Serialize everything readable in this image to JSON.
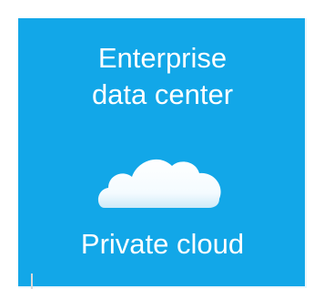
{
  "tile": {
    "title_line1": "Enterprise",
    "title_line2": "data center",
    "label": "Private cloud",
    "icon": "cloud-icon",
    "color": "#12a7e8"
  }
}
